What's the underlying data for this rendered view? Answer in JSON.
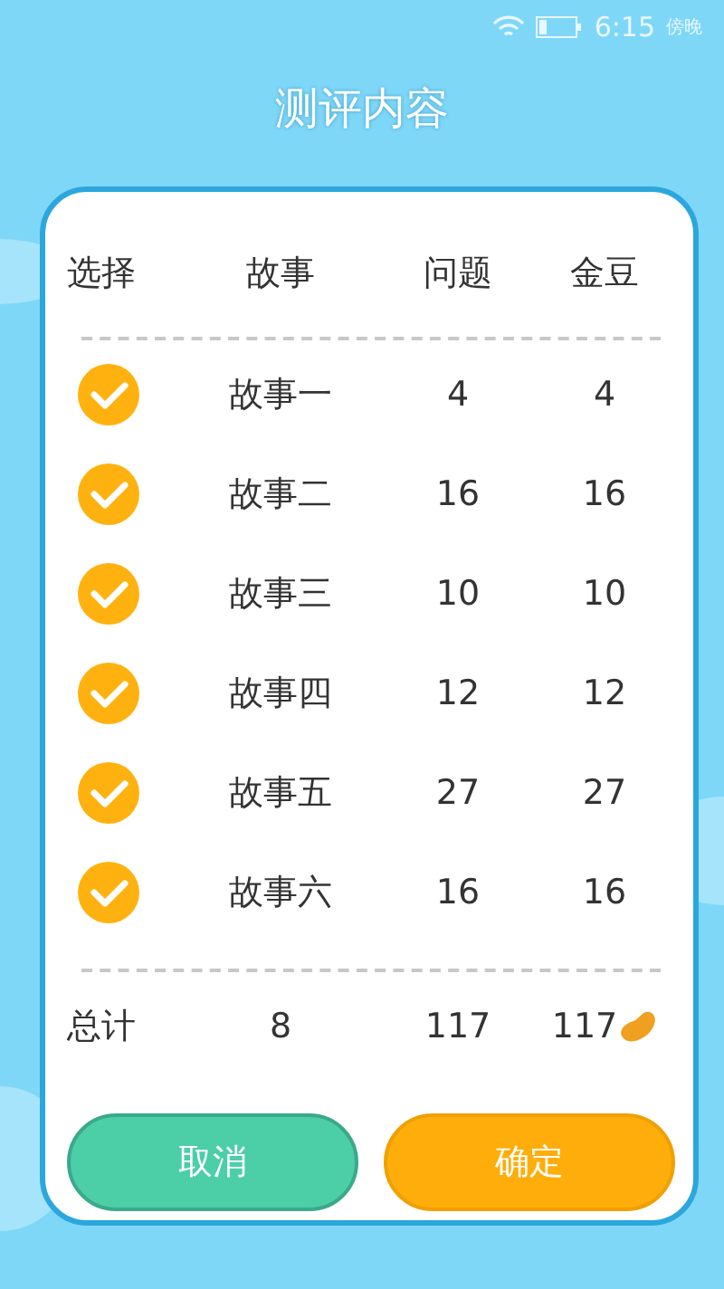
{
  "status_bar": {
    "time": "6:15",
    "period": "傍晚"
  },
  "title": "测评内容",
  "table": {
    "columns": [
      "选择",
      "故事",
      "问题",
      "金豆"
    ],
    "rows": [
      {
        "selected": true,
        "story": "故事一",
        "questions": "4",
        "coins": "4"
      },
      {
        "selected": true,
        "story": "故事二",
        "questions": "16",
        "coins": "16"
      },
      {
        "selected": true,
        "story": "故事三",
        "questions": "10",
        "coins": "10"
      },
      {
        "selected": true,
        "story": "故事四",
        "questions": "12",
        "coins": "12"
      },
      {
        "selected": true,
        "story": "故事五",
        "questions": "27",
        "coins": "27"
      },
      {
        "selected": true,
        "story": "故事六",
        "questions": "16",
        "coins": "16"
      }
    ]
  },
  "total": {
    "label": "总计",
    "count": "8",
    "questions": "117",
    "coins": "117"
  },
  "buttons": [
    {
      "kind": "cancel",
      "label": "取消"
    },
    {
      "kind": "confirm",
      "label": "确定"
    }
  ]
}
